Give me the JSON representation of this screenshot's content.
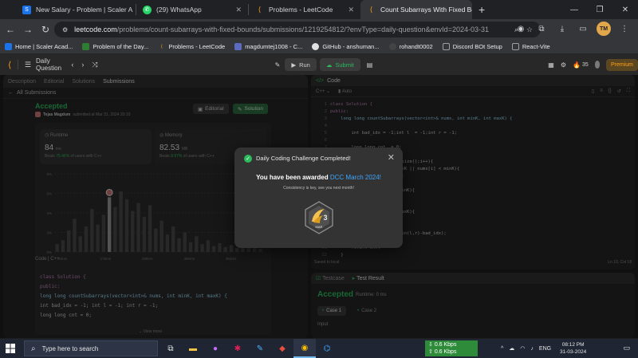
{
  "browser": {
    "tabs": [
      {
        "title": "New Salary - Problem | Scaler A",
        "icon_color": "#1a73e8",
        "icon": "scaler-icon"
      },
      {
        "title": "(29) WhatsApp",
        "icon_color": "#25d366",
        "icon": "whatsapp-icon"
      },
      {
        "title": "Problems - LeetCode",
        "icon_color": "#ffa116",
        "icon": "leetcode-icon"
      },
      {
        "title": "Count Subarrays With Fixed Bo",
        "icon_color": "#ffa116",
        "icon": "leetcode-icon"
      }
    ],
    "url_host": "leetcode.com",
    "url_path": "/problems/count-subarrays-with-fixed-bounds/submissions/1219254812/?envType=daily-question&envId=2024-03-31",
    "profile_initial": "TM"
  },
  "bookmarks": [
    {
      "label": "Home | Scaler Acad...",
      "color": "#1a73e8"
    },
    {
      "label": "Problem of the Day...",
      "color": "#2e7d32"
    },
    {
      "label": "Problems - LeetCode",
      "color": "#ffa116"
    },
    {
      "label": "magdumtej1008 - C...",
      "color": "#5c6bc0"
    },
    {
      "label": "GitHub - anshuman...",
      "color": "#e0e0e0"
    },
    {
      "label": "rohandt0002",
      "color": "#444"
    },
    {
      "label": "Discord BOt Setup",
      "color": "#9aa0a6"
    },
    {
      "label": "React-Vite",
      "color": "#9aa0a6"
    }
  ],
  "leetcode": {
    "daily_label": "Daily Question",
    "run_label": "Run",
    "submit_label": "Submit",
    "streak": "35",
    "premium_label": "Premium",
    "left_tabs": [
      "Description",
      "Editorial",
      "Solutions",
      "Submissions"
    ],
    "all_submissions": "All Submissions",
    "status": "Accepted",
    "submitted_by": "Tejas Magdum",
    "submitted_text": "submitted at Mar 31, 2024 20:10",
    "editorial_btn": "Editorial",
    "solution_btn": "Solution",
    "runtime": {
      "label": "Runtime",
      "value": "84",
      "unit": "ms",
      "beats_prefix": "Beats",
      "beats": "75.46%",
      "beats_suffix": "of users with C++"
    },
    "memory": {
      "label": "Memory",
      "value": "82.53",
      "unit": "MB",
      "beats_prefix": "Beats",
      "beats": "8.97%",
      "beats_suffix": "of users with C++"
    },
    "code_header": "Code  |  C++",
    "code_lines": [
      "class Solution {",
      "public:",
      "    long long countSubarrays(vector<int>& nums, int minK, int maxK) {",
      "",
      "        int bad_idx = -1; int l = -1; int r = -1;",
      "",
      "        long long cnt = 0;"
    ],
    "view_more": "View more",
    "code_tab": "Code",
    "language": "C++",
    "auto": "Auto",
    "editor_lines": [
      "class Solution {",
      "public:",
      "    long long countSubarrays(vector<int>& nums, int minK, int maxK) {",
      "",
      "        int bad_idx = -1;int l  = -1;int r = -1;",
      "",
      "        long long cnt  = 0;",
      "",
      "        for(int i=0;i<nums.size();i++){",
      "            if(nums[i] > maxK || nums[i] < minK){",
      "                bad_idx = i;",
      "            }",
      "            if(nums[i] == minK){",
      "                l = i;",
      "            }",
      "            if(nums[i] == maxK){",
      "                r = i;",
      "            }",
      "            cnt += max(0, min(l,r)-bad_idx);",
      "        }",
      "        return cnt;",
      "    }"
    ],
    "saved_local": "Saved to local",
    "cursor_pos": "Ln 10, Col 18",
    "testcase_tab": "Testcase",
    "result_tab": "Test Result",
    "result_status": "Accepted",
    "result_runtime": "Runtime: 0 ms",
    "case1": "Case 1",
    "case2": "Case 2",
    "input_label": "Input"
  },
  "modal": {
    "title": "Daily Coding Challenge Completed!",
    "award_prefix": "You have been awarded",
    "award_highlight": "DCC March 2024!",
    "subtitle": "Consistency is key, see you next month!",
    "badge_number": "3",
    "badge_month": "MAR"
  },
  "chart_data": {
    "type": "bar",
    "x_tick_labels": [
      "84ms",
      "176ms",
      "268ms",
      "360ms",
      "452ms"
    ],
    "y_tick_labels": [
      "8%",
      "6%",
      "4%",
      "2%",
      "0%"
    ],
    "ylim": [
      0,
      8
    ],
    "values": [
      0.8,
      1.2,
      2.2,
      3.4,
      1.6,
      2.6,
      4.4,
      2.8,
      3.8,
      5.6,
      4.6,
      6.2,
      5.4,
      4.2,
      5.0,
      3.6,
      4.8,
      2.4,
      3.2,
      1.8,
      2.6,
      1.4,
      2.0,
      1.0,
      1.6,
      0.8,
      1.2,
      0.6,
      0.9,
      0.5,
      0.7,
      0.4,
      0.6,
      0.5,
      0.4,
      0.3
    ],
    "highlight_index": 9
  },
  "taskbar": {
    "search_placeholder": "Type here to search",
    "net_down": "0.6 Kbps",
    "net_up": "0.6 Kbps",
    "lang": "ENG",
    "time": "08:12 PM",
    "date": "31-03-2024"
  }
}
